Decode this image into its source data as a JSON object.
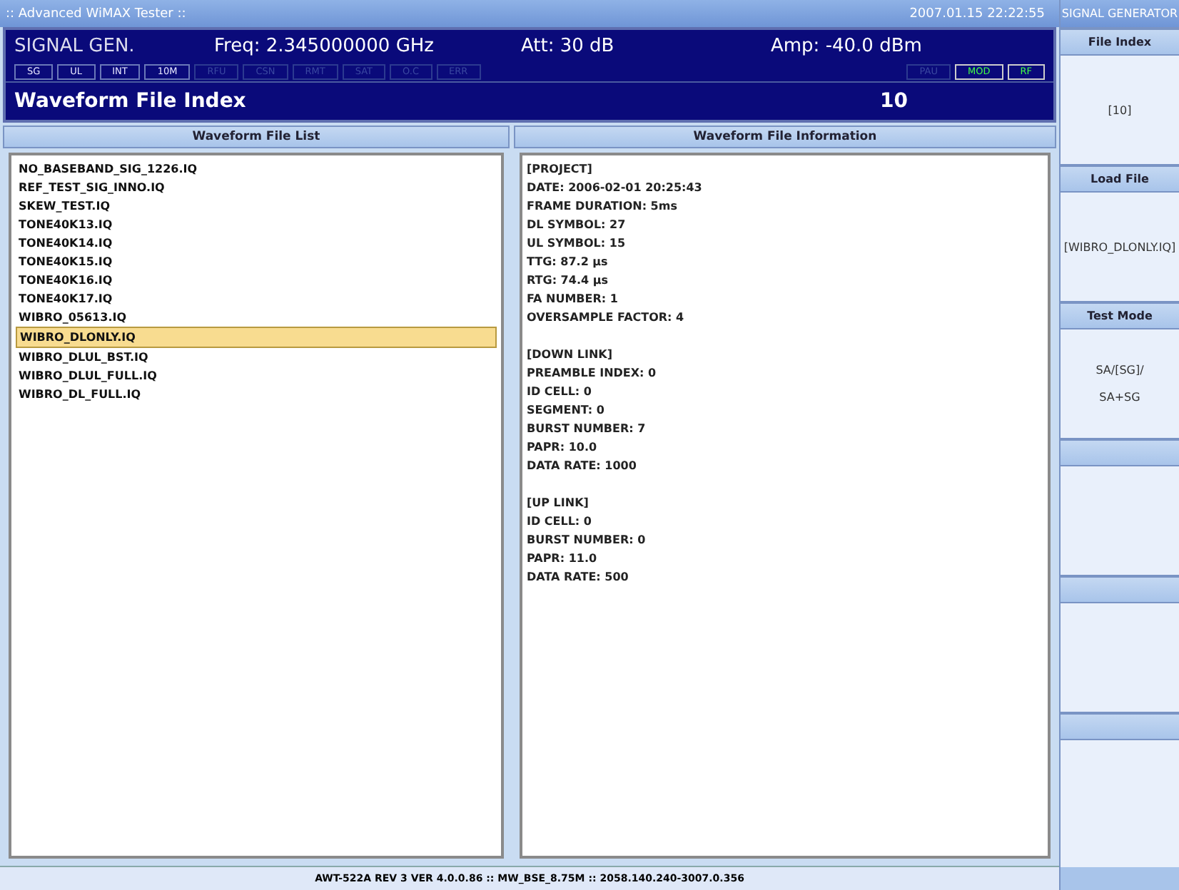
{
  "window": {
    "title": ":: Advanced WiMAX Tester ::",
    "datetime": "2007.01.15 22:22:55"
  },
  "header": {
    "mode": "SIGNAL GEN.",
    "freq": "Freq: 2.345000000 GHz",
    "att": "Att: 30 dB",
    "amp": "Amp: -40.0 dBm",
    "title": "Waveform File Index",
    "value": "10"
  },
  "indicators_left": [
    {
      "label": "SG",
      "on": true
    },
    {
      "label": "UL",
      "on": true
    },
    {
      "label": "INT",
      "on": true
    },
    {
      "label": "10M",
      "on": true
    },
    {
      "label": "RFU",
      "on": false
    },
    {
      "label": "CSN",
      "on": false
    },
    {
      "label": "RMT",
      "on": false
    },
    {
      "label": "SAT",
      "on": false
    },
    {
      "label": "O.C",
      "on": false
    },
    {
      "label": "ERR",
      "on": false
    }
  ],
  "indicators_right": [
    {
      "label": "PAU",
      "on": false
    },
    {
      "label": "MOD",
      "on": true
    },
    {
      "label": "RF",
      "on": true
    }
  ],
  "file_list": {
    "title": "Waveform File List",
    "items": [
      {
        "name": "NO_BASEBAND_SIG_1226.IQ",
        "selected": false
      },
      {
        "name": "REF_TEST_SIG_INNO.IQ",
        "selected": false
      },
      {
        "name": "SKEW_TEST.IQ",
        "selected": false
      },
      {
        "name": "TONE40K13.IQ",
        "selected": false
      },
      {
        "name": "TONE40K14.IQ",
        "selected": false
      },
      {
        "name": "TONE40K15.IQ",
        "selected": false
      },
      {
        "name": "TONE40K16.IQ",
        "selected": false
      },
      {
        "name": "TONE40K17.IQ",
        "selected": false
      },
      {
        "name": "WIBRO_05613.IQ",
        "selected": false
      },
      {
        "name": "WIBRO_DLONLY.IQ",
        "selected": true
      },
      {
        "name": "WIBRO_DLUL_BST.IQ",
        "selected": false
      },
      {
        "name": "WIBRO_DLUL_FULL.IQ",
        "selected": false
      },
      {
        "name": "WIBRO_DL_FULL.IQ",
        "selected": false
      }
    ]
  },
  "file_info": {
    "title": "Waveform File Information",
    "sections": [
      {
        "heading": "[PROJECT]",
        "lines": [
          "DATE: 2006-02-01 20:25:43",
          "FRAME DURATION: 5ms",
          "DL SYMBOL: 27",
          "UL SYMBOL: 15",
          "TTG: 87.2 µs",
          "RTG: 74.4 µs",
          "FA NUMBER: 1",
          "OVERSAMPLE FACTOR: 4"
        ]
      },
      {
        "heading": "[DOWN LINK]",
        "lines": [
          "PREAMBLE INDEX: 0",
          "ID CELL: 0",
          "SEGMENT: 0",
          "BURST NUMBER: 7",
          "PAPR: 10.0",
          "DATA RATE: 1000"
        ]
      },
      {
        "heading": "[UP LINK]",
        "lines": [
          "ID CELL: 0",
          "BURST NUMBER: 0",
          "PAPR: 11.0",
          "DATA RATE: 500"
        ]
      }
    ]
  },
  "status_bar": "AWT-522A REV 3 VER 4.0.0.86 :: MW_BSE_8.75M :: 2058.140.240-3007.0.356",
  "sidebar": {
    "title": "SIGNAL GENERATOR",
    "softkeys": [
      {
        "title": "File Index",
        "values": [
          "[10]"
        ]
      },
      {
        "title": "Load File",
        "values": [
          "[WIBRO_DLONLY.IQ]"
        ]
      },
      {
        "title": "Test Mode",
        "values": [
          "SA/[SG]/",
          "SA+SG"
        ]
      }
    ]
  }
}
